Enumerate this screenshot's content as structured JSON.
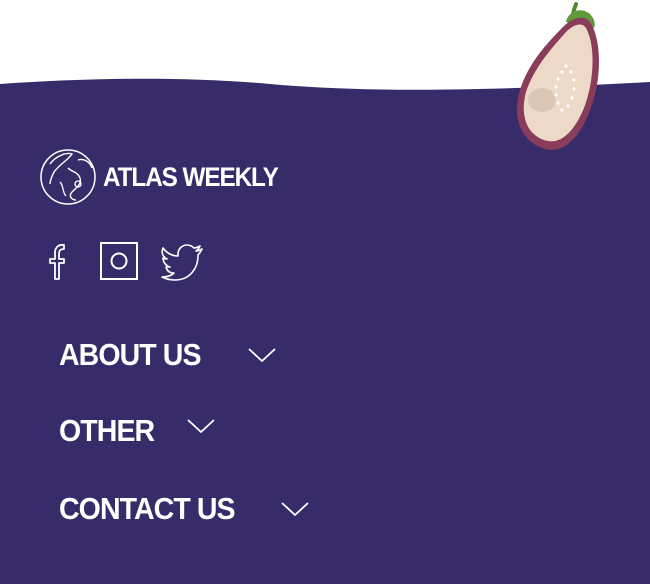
{
  "brand": {
    "name": "ATLAS WEEKLY"
  },
  "colors": {
    "footer": "#372c69",
    "text": "#ffffff",
    "eggplant_skin": "#8a3c5b",
    "eggplant_flesh": "#ecd9c8",
    "stem": "#5f9a3a"
  },
  "social": [
    {
      "icon": "facebook-icon"
    },
    {
      "icon": "instagram-icon"
    },
    {
      "icon": "twitter-icon"
    }
  ],
  "nav": {
    "items": [
      {
        "label": "ABOUT US",
        "icon": "chevron-down-icon"
      },
      {
        "label": "OTHER",
        "icon": "chevron-down-icon"
      },
      {
        "label": "CONTACT US",
        "icon": "chevron-down-icon"
      }
    ]
  }
}
